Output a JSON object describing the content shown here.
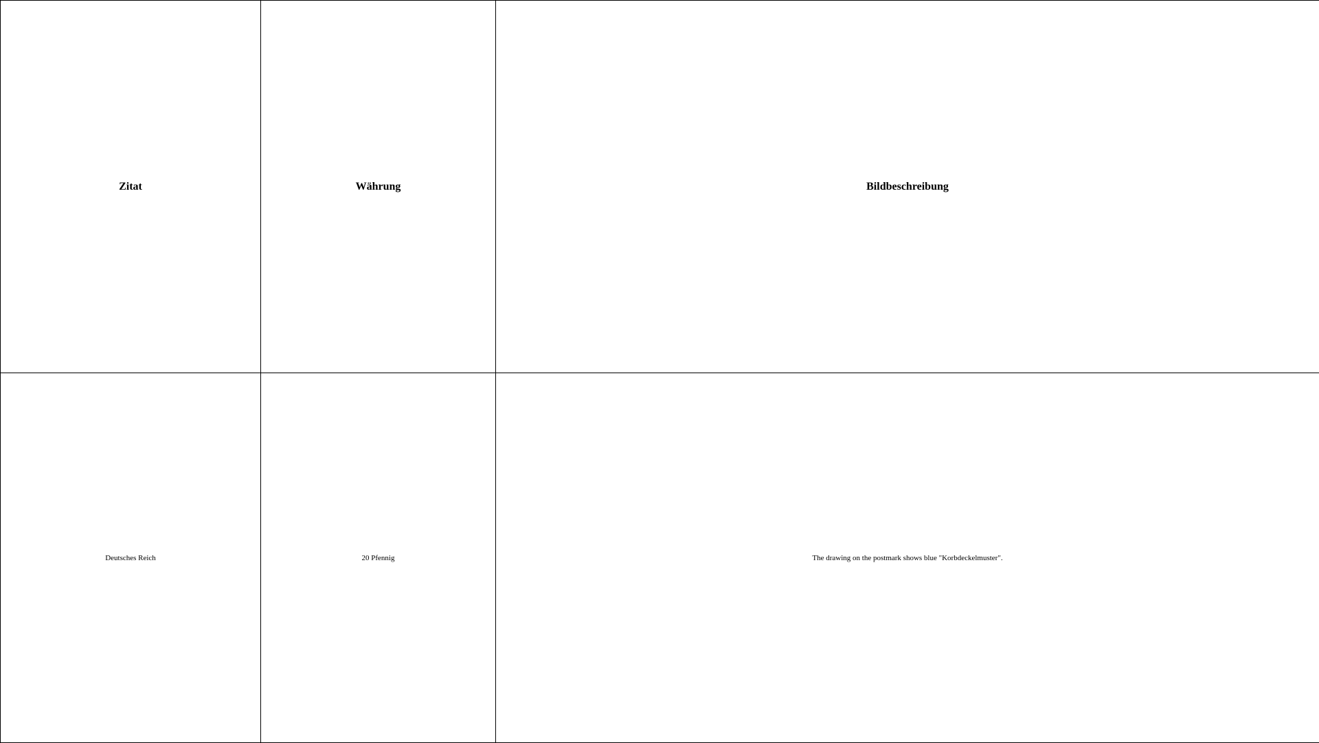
{
  "table": {
    "headers": [
      "Zitat",
      "Währung",
      "Bildbeschreibung"
    ],
    "rows": [
      [
        "Deutsches Reich",
        "20 Pfennig",
        "The drawing on the postmark shows blue \"Korbdeckelmuster\"."
      ]
    ]
  }
}
